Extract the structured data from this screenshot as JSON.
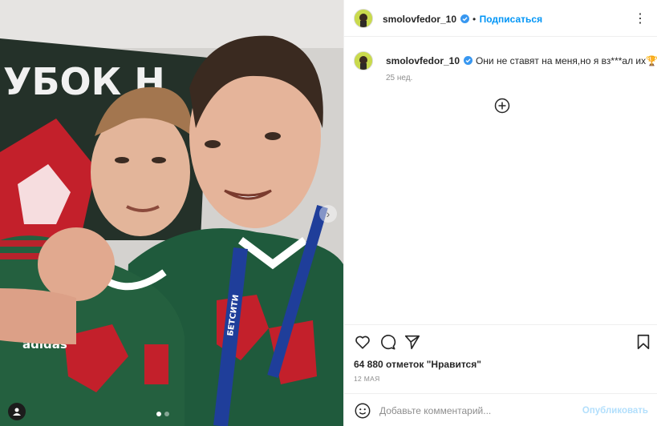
{
  "post": {
    "username": "smolovfedor_10",
    "separator": "•",
    "follow_label": "Подписаться",
    "more_label": "⋮",
    "caption": "Они не ставят на меня,но я вз***ал их🏆❤️",
    "caption_age": "25 нед.",
    "likes": "64 880 отметок \"Нравится\"",
    "date": "12 МАЯ",
    "comment_placeholder": "Добавьте комментарий...",
    "publish_label": "Опубликовать",
    "photo_banner_text": "УБОК Н",
    "jersey_sponsor": "adidas",
    "lanyard_text": "БЕТСИТИ"
  },
  "carousel": {
    "dot_count": 2,
    "active_dot": 1
  },
  "colors": {
    "follow": "#0095f6",
    "publish_disabled": "#b2dffc",
    "muted": "#8e8e8e",
    "border": "#efefef",
    "jersey_green": "#1f5a3c",
    "crest_red": "#c3202b"
  },
  "icons": [
    "verified-badge-icon",
    "more-options-icon",
    "load-more-comments-icon",
    "heart-icon",
    "comment-icon",
    "share-icon",
    "bookmark-icon",
    "emoji-icon",
    "tagged-user-icon",
    "carousel-next-icon"
  ]
}
